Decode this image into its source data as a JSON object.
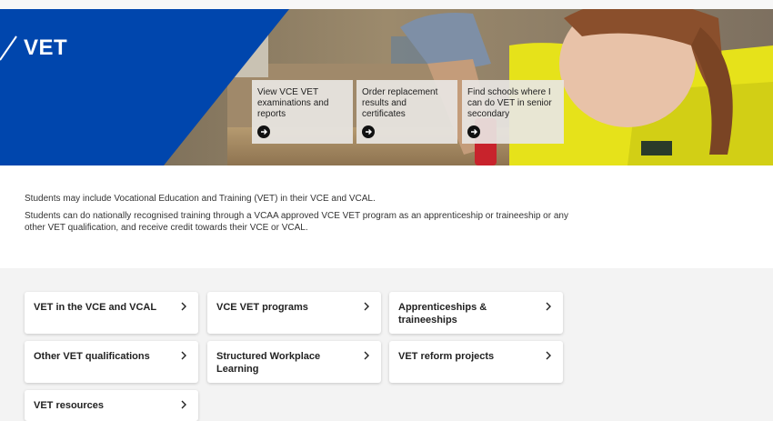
{
  "hero": {
    "title": "VET",
    "quick_links": [
      {
        "label": "View VCE VET examinations and reports"
      },
      {
        "label": "Order replacement results and certificates"
      },
      {
        "label": "Find schools where I can do VET in senior secondary"
      }
    ]
  },
  "intro": {
    "paragraph_1": "Students may include Vocational Education and Training (VET) in their VCE and VCAL.",
    "paragraph_2": "Students can do nationally recognised training through a VCAA approved VCE VET program as an apprenticeship or traineeship or any other VET qualification, and receive credit towards their VCE or VCAL."
  },
  "nav_cards": [
    {
      "label": "VET in the VCE and VCAL"
    },
    {
      "label": "VCE VET programs"
    },
    {
      "label": "Apprenticeships & traineeships"
    },
    {
      "label": "Other VET qualifications"
    },
    {
      "label": "Structured Workplace Learning"
    },
    {
      "label": "VET reform projects"
    },
    {
      "label": "VET resources"
    }
  ],
  "colors": {
    "brand_blue": "#0046ad",
    "hivis_yellow": "#e6e21a"
  }
}
